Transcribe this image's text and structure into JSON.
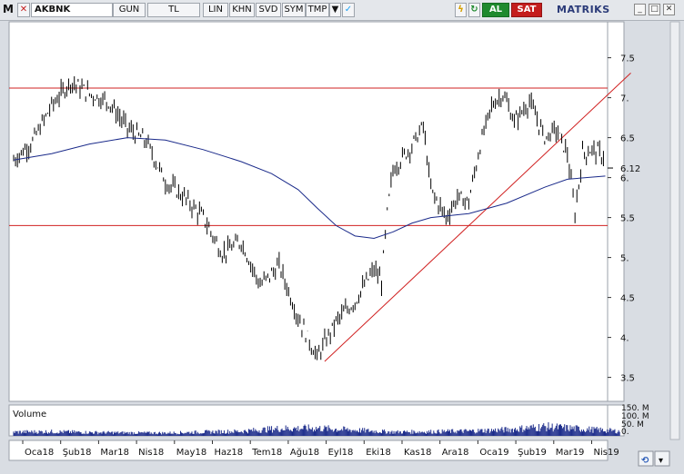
{
  "toolbar": {
    "menu_label": "M",
    "symbol": "AKBNK",
    "period": "GUN",
    "currency": "TL",
    "buttons": [
      "LIN",
      "KHN",
      "SVD",
      "SYM",
      "TMP"
    ],
    "al_label": "AL",
    "sat_label": "SAT",
    "brand": "MATRIKS"
  },
  "chart_data": [
    {
      "type": "line",
      "name": "price",
      "x_ticks": [
        "Oca18",
        "Şub18",
        "Mar18",
        "Nis18",
        "May18",
        "Haz18",
        "Tem18",
        "Ağu18",
        "Eyl18",
        "Eki18",
        "Kas18",
        "Ara18",
        "Oca19",
        "Şub19",
        "Mar19",
        "Nis19"
      ],
      "y_ticks": [
        3.5,
        4.0,
        4.5,
        5.0,
        5.5,
        6.0,
        6.5,
        7.0,
        7.5
      ],
      "y_tick_labels": [
        "3.5",
        "4.",
        "4.5",
        "5.",
        "5.5",
        "6.",
        "6.5",
        "7.",
        "7.5"
      ],
      "ylim": [
        3.2,
        7.95
      ],
      "last_value": 6.12,
      "last_value_label": "6.12",
      "price_monthly": [
        [
          0,
          6.22
        ],
        [
          0.5,
          6.45
        ],
        [
          1,
          6.9
        ],
        [
          1.5,
          7.2
        ],
        [
          2,
          7.05
        ],
        [
          2.5,
          6.95
        ],
        [
          3,
          6.62
        ],
        [
          3.5,
          6.45
        ],
        [
          4,
          5.95
        ],
        [
          4.5,
          5.75
        ],
        [
          5,
          5.5
        ],
        [
          5.5,
          5.05
        ],
        [
          6,
          5.2
        ],
        [
          6.5,
          4.65
        ],
        [
          7,
          4.9
        ],
        [
          7.5,
          4.25
        ],
        [
          8,
          3.75
        ],
        [
          8.5,
          4.2
        ],
        [
          9,
          4.45
        ],
        [
          9.5,
          4.85
        ],
        [
          9.7,
          4.7
        ],
        [
          9.85,
          5.55
        ],
        [
          10,
          6.1
        ],
        [
          10.5,
          6.4
        ],
        [
          10.8,
          6.65
        ],
        [
          11,
          5.85
        ],
        [
          11.4,
          5.5
        ],
        [
          11.7,
          5.75
        ],
        [
          12,
          5.7
        ],
        [
          12.3,
          6.4
        ],
        [
          12.6,
          6.9
        ],
        [
          12.9,
          7.05
        ],
        [
          13.2,
          6.7
        ],
        [
          13.6,
          6.95
        ],
        [
          14,
          6.5
        ],
        [
          14.3,
          6.6
        ],
        [
          14.6,
          6.3
        ],
        [
          14.8,
          5.55
        ],
        [
          15,
          6.3
        ],
        [
          15.3,
          6.35
        ],
        [
          15.6,
          6.25
        ]
      ],
      "moving_average": [
        [
          0,
          6.22
        ],
        [
          1,
          6.3
        ],
        [
          2,
          6.42
        ],
        [
          3,
          6.5
        ],
        [
          4,
          6.47
        ],
        [
          5,
          6.35
        ],
        [
          6,
          6.2
        ],
        [
          6.8,
          6.05
        ],
        [
          7.5,
          5.85
        ],
        [
          8,
          5.62
        ],
        [
          8.5,
          5.4
        ],
        [
          9,
          5.27
        ],
        [
          9.5,
          5.24
        ],
        [
          10,
          5.32
        ],
        [
          10.5,
          5.43
        ],
        [
          11,
          5.5
        ],
        [
          12,
          5.55
        ],
        [
          13,
          5.68
        ],
        [
          14,
          5.88
        ],
        [
          14.6,
          5.98
        ],
        [
          15.6,
          6.02
        ]
      ],
      "horizontal_lines": [
        7.12,
        5.4
      ],
      "trend_line": {
        "from": [
          8.2,
          3.7
        ],
        "to": [
          15.6,
          7.15
        ]
      }
    },
    {
      "type": "bar",
      "name": "volume",
      "title": "Volume",
      "y_tick_labels": [
        "150. M",
        "100. M",
        "50. M",
        "0."
      ],
      "values_monthly_M": [
        20,
        22,
        18,
        16,
        15,
        20,
        24,
        38,
        40,
        30,
        20,
        22,
        25,
        32,
        48,
        36
      ]
    }
  ]
}
